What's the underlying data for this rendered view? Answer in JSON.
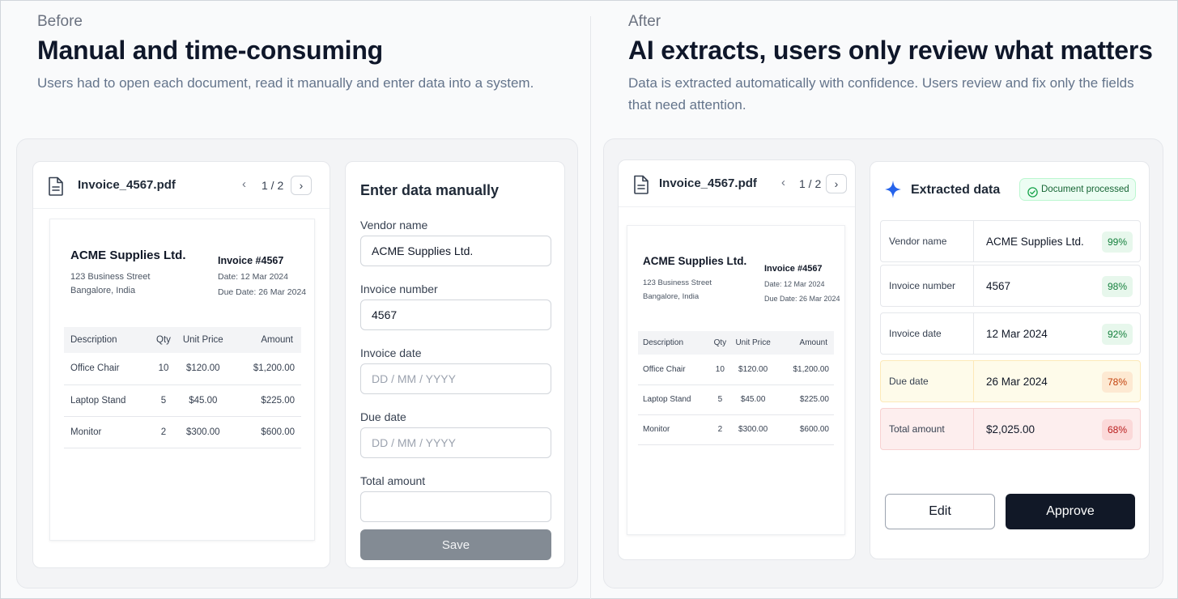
{
  "before": {
    "eyebrow": "Before",
    "headline": "Manual and time-consuming",
    "subtitle": "Users had to open each document, read it manually and enter data into a system.",
    "viewer": {
      "file_name": "Invoice_4567.pdf",
      "pager": "1 / 2",
      "prev_icon": "chevron-left-icon",
      "next_icon": "chevron-right-icon"
    },
    "form": {
      "title": "Enter data manually",
      "fields": [
        {
          "label": "Vendor name",
          "value": "ACME Supplies Ltd.",
          "placeholder": ""
        },
        {
          "label": "Invoice number",
          "value": "4567",
          "placeholder": ""
        },
        {
          "label": "Invoice date",
          "value": "",
          "placeholder": "DD / MM / YYYY"
        },
        {
          "label": "Due date",
          "value": "",
          "placeholder": "DD / MM / YYYY"
        },
        {
          "label": "Total amount",
          "value": "",
          "placeholder": ""
        }
      ],
      "save_label": "Save"
    }
  },
  "after": {
    "eyebrow": "After",
    "headline": "AI extracts, users only review what matters",
    "subtitle_line1": "Data is extracted automatically with confidence. Users review and fix only the fields",
    "subtitle_line2": "that need attention.",
    "viewer": {
      "file_name": "Invoice_4567.pdf",
      "pager": "1 / 2"
    },
    "extracted": {
      "title": "Extracted data",
      "badge": "Document processed",
      "rows": [
        {
          "label": "Vendor name",
          "value": "ACME Supplies Ltd.",
          "confidence": "99%",
          "status": "high"
        },
        {
          "label": "Invoice number",
          "value": "4567",
          "confidence": "98%",
          "status": "high"
        },
        {
          "label": "Invoice date",
          "value": "12 Mar 2024",
          "confidence": "92%",
          "status": "high"
        },
        {
          "label": "Due date",
          "value": "26 Mar 2024",
          "confidence": "78%",
          "status": "medium"
        },
        {
          "label": "Total amount",
          "value": "$2,025.00",
          "confidence": "68%",
          "status": "low"
        }
      ],
      "edit_label": "Edit",
      "approve_label": "Approve"
    }
  },
  "invoice": {
    "vendor": "ACME Supplies Ltd.",
    "address_line1": "123 Business Street",
    "address_line2": "Bangalore, India",
    "invoice_no": "Invoice #4567",
    "date": "Date: 12 Mar 2024",
    "due_date": "Due Date: 26 Mar 2024",
    "columns": [
      "Description",
      "Qty",
      "Unit Price",
      "Amount"
    ],
    "items": [
      [
        "Office Chair",
        "10",
        "$120.00",
        "$1,200.00"
      ],
      [
        "Laptop Stand",
        "5",
        "$45.00",
        "$225.00"
      ],
      [
        "Monitor",
        "2",
        "$300.00",
        "$600.00"
      ]
    ]
  },
  "colors": {
    "high_bg": "#e7f7ec",
    "high_fg": "#15803d",
    "medium_bg": "#fde9d2",
    "medium_fg": "#c2410c",
    "low_bg": "#fbd9d9",
    "low_fg": "#b91c1c",
    "primary": "#111827"
  }
}
